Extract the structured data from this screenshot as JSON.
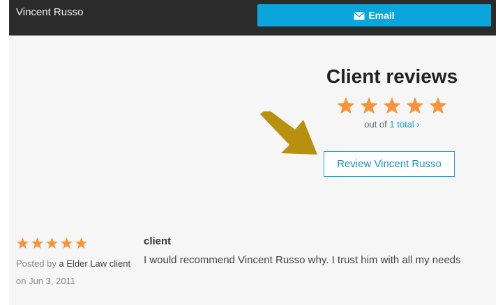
{
  "header": {
    "attorney_name": "Vincent Russo",
    "email_button_label": "Email",
    "email_icon": "envelope-icon"
  },
  "reviews_summary": {
    "title": "Client reviews",
    "rating": 5,
    "max_rating": 5,
    "out_of_prefix": "out of",
    "total_link": "1 total",
    "total_chevron": "›",
    "review_button_label": "Review Vincent Russo"
  },
  "review": {
    "rating": 5,
    "posted_by_prefix": "Posted by",
    "author": "a Elder Law client",
    "date": "on Jun 3, 2011",
    "heading": "client",
    "text": "I would recommend Vincent Russo why. I trust him with all my needs"
  },
  "colors": {
    "star": "#f7933a",
    "accent": "#0aa5da",
    "header_bg": "#2b2b2b",
    "annotation_arrow": "#b8900f"
  }
}
